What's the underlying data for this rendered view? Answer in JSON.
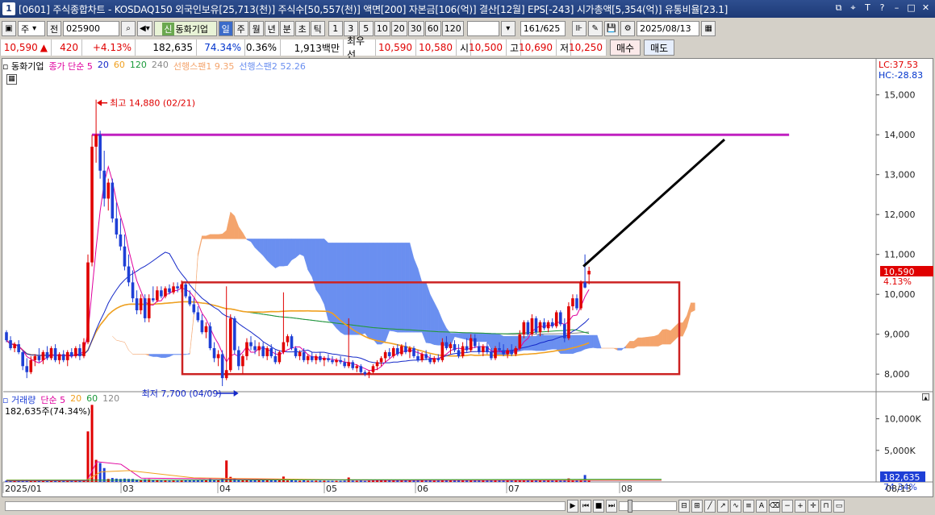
{
  "titlebar": {
    "window_index": "1",
    "title": "[0601] 주식종합차트 - KOSDAQ150 외국인보유[25,713(천)] 주식수[50,557(천)] 액면[200] 자본금[106(억)] 결산[12월] EPS[-243] 시가총액[5,354(억)] 유통비율[23.1]"
  },
  "toolbar": {
    "market": "주",
    "prev_label": "전",
    "code": "025900",
    "stock_tag": "신",
    "stock_name": "동화기업",
    "periods": [
      "일",
      "주",
      "월",
      "년",
      "분",
      "초",
      "틱"
    ],
    "active_period": "일",
    "intervals": [
      "1",
      "3",
      "5",
      "10",
      "20",
      "30",
      "60",
      "120"
    ],
    "count": "161",
    "total": "/625",
    "date": "2025/08/13"
  },
  "quote": {
    "price": "10,590",
    "change_arrow": "▲",
    "change": "420",
    "change_pct": "+4.13%",
    "volume": "182,635",
    "vol_ratio": "74.34%",
    "turnover": "0.36%",
    "amount": "1,913백만",
    "best_label": "최우선",
    "best_ask": "10,590",
    "best_bid": "10,580",
    "open_label": "시",
    "open": "10,500",
    "high_label": "고",
    "high": "10,690",
    "low_label": "저",
    "low": "10,250",
    "buy_label": "매수",
    "sell_label": "매도"
  },
  "legend": {
    "stock": "동화기업",
    "ma_label": "종가 단순 5",
    "ma20": "20",
    "ma60": "60",
    "ma120": "120",
    "ma240": "240",
    "span1": "선행스팬1 9.35",
    "span2": "선행스팬2 52.26",
    "lc": "LC:37.53",
    "hc": "HC:-28.83"
  },
  "volume_legend": {
    "label": "거래량",
    "ma_label": "단순 5",
    "ma20": "20",
    "ma60": "60",
    "ma120": "120",
    "info": "182,635주(74.34%)"
  },
  "colors": {
    "up": "#e00000",
    "down": "#1e3fd6",
    "cloud_blue": "#6a8ff0",
    "cloud_orange": "#f4a46c",
    "ma5": "#e0009e",
    "ma20": "#1428c8",
    "ma60": "#f0a020",
    "ma120": "#1a9a3a",
    "ma240": "#888888",
    "box": "#cc2222",
    "hline": "#c020c0"
  },
  "chart_data": {
    "type": "candlestick",
    "y_unit": "KRW",
    "ylim": [
      7600,
      15600
    ],
    "y_ticks": [
      8000,
      9000,
      10000,
      11000,
      12000,
      13000,
      14000,
      15000
    ],
    "y_tick_labels": [
      "8,000",
      "9,000",
      "10,000",
      "11,000",
      "12,000",
      "13,000",
      "14,000",
      "15,000"
    ],
    "x_labels": [
      "2025/01",
      "03",
      "04",
      "05",
      "06",
      "07",
      "08"
    ],
    "x_end_label": "08/13",
    "annotations": {
      "high": "최고 14,880 (02/21)",
      "low": "최저 7,700 (04/09)",
      "current": "10,590",
      "current_pct": "4.13%"
    },
    "horizontal_line_value": 14000,
    "ohlc": [
      {
        "o": 9050,
        "h": 9100,
        "l": 8800,
        "c": 8850
      },
      {
        "o": 8850,
        "h": 8950,
        "l": 8600,
        "c": 8650
      },
      {
        "o": 8650,
        "h": 8800,
        "l": 8550,
        "c": 8750
      },
      {
        "o": 8750,
        "h": 8850,
        "l": 8500,
        "c": 8550
      },
      {
        "o": 8550,
        "h": 8600,
        "l": 8100,
        "c": 8200
      },
      {
        "o": 8200,
        "h": 8400,
        "l": 7900,
        "c": 8050
      },
      {
        "o": 8050,
        "h": 8450,
        "l": 8000,
        "c": 8350
      },
      {
        "o": 8350,
        "h": 8500,
        "l": 8200,
        "c": 8450
      },
      {
        "o": 8450,
        "h": 8650,
        "l": 8300,
        "c": 8350
      },
      {
        "o": 8350,
        "h": 8600,
        "l": 8250,
        "c": 8550
      },
      {
        "o": 8550,
        "h": 8700,
        "l": 8350,
        "c": 8400
      },
      {
        "o": 8400,
        "h": 8700,
        "l": 8350,
        "c": 8650
      },
      {
        "o": 8650,
        "h": 8750,
        "l": 8300,
        "c": 8350
      },
      {
        "o": 8350,
        "h": 8550,
        "l": 8250,
        "c": 8500
      },
      {
        "o": 8500,
        "h": 8600,
        "l": 8300,
        "c": 8350
      },
      {
        "o": 8350,
        "h": 8600,
        "l": 8200,
        "c": 8550
      },
      {
        "o": 8550,
        "h": 8650,
        "l": 8400,
        "c": 8450
      },
      {
        "o": 8450,
        "h": 8700,
        "l": 8400,
        "c": 8650
      },
      {
        "o": 8650,
        "h": 8750,
        "l": 8350,
        "c": 8450
      },
      {
        "o": 8450,
        "h": 8900,
        "l": 8400,
        "c": 8800
      },
      {
        "o": 8800,
        "h": 11000,
        "l": 8750,
        "c": 10800
      },
      {
        "o": 10800,
        "h": 14000,
        "l": 10700,
        "c": 13700
      },
      {
        "o": 13700,
        "h": 14880,
        "l": 13300,
        "c": 14000
      },
      {
        "o": 14000,
        "h": 14100,
        "l": 12900,
        "c": 13100
      },
      {
        "o": 13100,
        "h": 13600,
        "l": 12200,
        "c": 12400
      },
      {
        "o": 12400,
        "h": 12900,
        "l": 12100,
        "c": 12800
      },
      {
        "o": 12800,
        "h": 12900,
        "l": 11800,
        "c": 11900
      },
      {
        "o": 11900,
        "h": 12300,
        "l": 11400,
        "c": 11500
      },
      {
        "o": 11500,
        "h": 11900,
        "l": 11100,
        "c": 11200
      },
      {
        "o": 11200,
        "h": 11500,
        "l": 10600,
        "c": 10700
      },
      {
        "o": 10700,
        "h": 11000,
        "l": 10200,
        "c": 10300
      },
      {
        "o": 10300,
        "h": 10600,
        "l": 9800,
        "c": 9900
      },
      {
        "o": 9900,
        "h": 10100,
        "l": 9500,
        "c": 9600
      },
      {
        "o": 9600,
        "h": 10000,
        "l": 9500,
        "c": 9900
      },
      {
        "o": 9900,
        "h": 10000,
        "l": 9300,
        "c": 9400
      },
      {
        "o": 9400,
        "h": 10000,
        "l": 9300,
        "c": 9900
      },
      {
        "o": 9900,
        "h": 10200,
        "l": 9800,
        "c": 9850
      },
      {
        "o": 9850,
        "h": 10200,
        "l": 9800,
        "c": 10100
      },
      {
        "o": 10100,
        "h": 10200,
        "l": 9900,
        "c": 9950
      },
      {
        "o": 9950,
        "h": 10200,
        "l": 9900,
        "c": 10150
      },
      {
        "o": 10150,
        "h": 10250,
        "l": 10000,
        "c": 10050
      },
      {
        "o": 10050,
        "h": 10300,
        "l": 10000,
        "c": 10200
      },
      {
        "o": 10200,
        "h": 10300,
        "l": 10050,
        "c": 10150
      },
      {
        "o": 10150,
        "h": 10350,
        "l": 10050,
        "c": 10250
      },
      {
        "o": 10250,
        "h": 10300,
        "l": 9900,
        "c": 9950
      },
      {
        "o": 9950,
        "h": 10100,
        "l": 9700,
        "c": 9750
      },
      {
        "o": 9750,
        "h": 9900,
        "l": 9500,
        "c": 9550
      },
      {
        "o": 9550,
        "h": 9700,
        "l": 9300,
        "c": 9350
      },
      {
        "o": 9350,
        "h": 9500,
        "l": 9000,
        "c": 9050
      },
      {
        "o": 9050,
        "h": 9300,
        "l": 8900,
        "c": 9200
      },
      {
        "o": 9200,
        "h": 9300,
        "l": 8600,
        "c": 8650
      },
      {
        "o": 8650,
        "h": 8800,
        "l": 8300,
        "c": 8400
      },
      {
        "o": 8400,
        "h": 8600,
        "l": 8200,
        "c": 8500
      },
      {
        "o": 8500,
        "h": 8600,
        "l": 7700,
        "c": 7900
      },
      {
        "o": 7900,
        "h": 10200,
        "l": 7850,
        "c": 8100
      },
      {
        "o": 8100,
        "h": 9500,
        "l": 8050,
        "c": 9400
      },
      {
        "o": 9400,
        "h": 9450,
        "l": 8500,
        "c": 8600
      },
      {
        "o": 8600,
        "h": 8700,
        "l": 8100,
        "c": 8200
      },
      {
        "o": 8200,
        "h": 8500,
        "l": 8000,
        "c": 8450
      },
      {
        "o": 8450,
        "h": 8900,
        "l": 8350,
        "c": 8800
      },
      {
        "o": 8800,
        "h": 8950,
        "l": 8600,
        "c": 8700
      },
      {
        "o": 8700,
        "h": 8850,
        "l": 8500,
        "c": 8600
      },
      {
        "o": 8600,
        "h": 8800,
        "l": 8450,
        "c": 8700
      },
      {
        "o": 8700,
        "h": 8800,
        "l": 8400,
        "c": 8450
      },
      {
        "o": 8450,
        "h": 8700,
        "l": 8350,
        "c": 8650
      },
      {
        "o": 8650,
        "h": 8750,
        "l": 8400,
        "c": 8450
      },
      {
        "o": 8450,
        "h": 8600,
        "l": 8250,
        "c": 8300
      },
      {
        "o": 8300,
        "h": 8600,
        "l": 8250,
        "c": 8550
      },
      {
        "o": 8550,
        "h": 10050,
        "l": 8500,
        "c": 8800
      },
      {
        "o": 8800,
        "h": 9000,
        "l": 8700,
        "c": 8950
      },
      {
        "o": 8950,
        "h": 9000,
        "l": 8600,
        "c": 8650
      },
      {
        "o": 8650,
        "h": 8700,
        "l": 8400,
        "c": 8450
      },
      {
        "o": 8450,
        "h": 8600,
        "l": 8350,
        "c": 8550
      },
      {
        "o": 8550,
        "h": 8650,
        "l": 8300,
        "c": 8350
      },
      {
        "o": 8350,
        "h": 8500,
        "l": 8250,
        "c": 8450
      },
      {
        "o": 8450,
        "h": 8550,
        "l": 8300,
        "c": 8350
      },
      {
        "o": 8350,
        "h": 8500,
        "l": 8250,
        "c": 8450
      },
      {
        "o": 8450,
        "h": 8550,
        "l": 8300,
        "c": 8350
      },
      {
        "o": 8350,
        "h": 8450,
        "l": 8200,
        "c": 8400
      },
      {
        "o": 8400,
        "h": 8500,
        "l": 8300,
        "c": 8350
      },
      {
        "o": 8350,
        "h": 8450,
        "l": 8250,
        "c": 8300
      },
      {
        "o": 8300,
        "h": 8400,
        "l": 8200,
        "c": 8350
      },
      {
        "o": 8350,
        "h": 8450,
        "l": 8250,
        "c": 8300
      },
      {
        "o": 8300,
        "h": 8400,
        "l": 8150,
        "c": 8200
      },
      {
        "o": 8200,
        "h": 9400,
        "l": 8150,
        "c": 8300
      },
      {
        "o": 8300,
        "h": 8350,
        "l": 8100,
        "c": 8150
      },
      {
        "o": 8150,
        "h": 8250,
        "l": 8050,
        "c": 8200
      },
      {
        "o": 8200,
        "h": 8250,
        "l": 8000,
        "c": 8050
      },
      {
        "o": 8050,
        "h": 8100,
        "l": 7950,
        "c": 8000
      },
      {
        "o": 8000,
        "h": 8100,
        "l": 7900,
        "c": 8050
      },
      {
        "o": 8050,
        "h": 8250,
        "l": 8000,
        "c": 8200
      },
      {
        "o": 8200,
        "h": 8350,
        "l": 8100,
        "c": 8300
      },
      {
        "o": 8300,
        "h": 8450,
        "l": 8200,
        "c": 8400
      },
      {
        "o": 8400,
        "h": 8600,
        "l": 8300,
        "c": 8550
      },
      {
        "o": 8550,
        "h": 8650,
        "l": 8400,
        "c": 8450
      },
      {
        "o": 8450,
        "h": 8700,
        "l": 8400,
        "c": 8650
      },
      {
        "o": 8650,
        "h": 8750,
        "l": 8450,
        "c": 8500
      },
      {
        "o": 8500,
        "h": 8750,
        "l": 8450,
        "c": 8700
      },
      {
        "o": 8700,
        "h": 8800,
        "l": 8500,
        "c": 8550
      },
      {
        "o": 8550,
        "h": 8700,
        "l": 8400,
        "c": 8650
      },
      {
        "o": 8650,
        "h": 8700,
        "l": 8400,
        "c": 8450
      },
      {
        "o": 8450,
        "h": 8600,
        "l": 8300,
        "c": 8350
      },
      {
        "o": 8350,
        "h": 8550,
        "l": 8300,
        "c": 8500
      },
      {
        "o": 8500,
        "h": 8600,
        "l": 8350,
        "c": 8400
      },
      {
        "o": 8400,
        "h": 8500,
        "l": 8250,
        "c": 8300
      },
      {
        "o": 8300,
        "h": 8450,
        "l": 8250,
        "c": 8400
      },
      {
        "o": 8400,
        "h": 8500,
        "l": 8300,
        "c": 8350
      },
      {
        "o": 8350,
        "h": 8900,
        "l": 8300,
        "c": 8800
      },
      {
        "o": 8800,
        "h": 8950,
        "l": 8600,
        "c": 8650
      },
      {
        "o": 8650,
        "h": 8800,
        "l": 8500,
        "c": 8750
      },
      {
        "o": 8750,
        "h": 8850,
        "l": 8550,
        "c": 8600
      },
      {
        "o": 8600,
        "h": 8750,
        "l": 8400,
        "c": 8450
      },
      {
        "o": 8450,
        "h": 8800,
        "l": 8400,
        "c": 8700
      },
      {
        "o": 8700,
        "h": 8900,
        "l": 8550,
        "c": 8600
      },
      {
        "o": 8600,
        "h": 9000,
        "l": 8550,
        "c": 8900
      },
      {
        "o": 8900,
        "h": 9000,
        "l": 8650,
        "c": 8700
      },
      {
        "o": 8700,
        "h": 8800,
        "l": 8500,
        "c": 8550
      },
      {
        "o": 8550,
        "h": 8750,
        "l": 8450,
        "c": 8700
      },
      {
        "o": 8700,
        "h": 8800,
        "l": 8500,
        "c": 8550
      },
      {
        "o": 8550,
        "h": 8650,
        "l": 8350,
        "c": 8400
      },
      {
        "o": 8400,
        "h": 8700,
        "l": 8350,
        "c": 8650
      },
      {
        "o": 8650,
        "h": 8800,
        "l": 8550,
        "c": 8600
      },
      {
        "o": 8600,
        "h": 8750,
        "l": 8450,
        "c": 8500
      },
      {
        "o": 8500,
        "h": 8650,
        "l": 8400,
        "c": 8600
      },
      {
        "o": 8600,
        "h": 8750,
        "l": 8450,
        "c": 8500
      },
      {
        "o": 8500,
        "h": 8700,
        "l": 8450,
        "c": 8650
      },
      {
        "o": 8650,
        "h": 9100,
        "l": 8600,
        "c": 9000
      },
      {
        "o": 9000,
        "h": 9350,
        "l": 8900,
        "c": 9300
      },
      {
        "o": 9300,
        "h": 9350,
        "l": 8950,
        "c": 9000
      },
      {
        "o": 9000,
        "h": 9500,
        "l": 8950,
        "c": 9400
      },
      {
        "o": 9400,
        "h": 9450,
        "l": 9000,
        "c": 9050
      },
      {
        "o": 9050,
        "h": 9350,
        "l": 8950,
        "c": 9300
      },
      {
        "o": 9300,
        "h": 9400,
        "l": 9100,
        "c": 9150
      },
      {
        "o": 9150,
        "h": 9350,
        "l": 9050,
        "c": 9300
      },
      {
        "o": 9300,
        "h": 9400,
        "l": 9150,
        "c": 9200
      },
      {
        "o": 9200,
        "h": 9600,
        "l": 9150,
        "c": 9550
      },
      {
        "o": 9550,
        "h": 9600,
        "l": 9200,
        "c": 9250
      },
      {
        "o": 9250,
        "h": 9400,
        "l": 8800,
        "c": 8900
      },
      {
        "o": 8900,
        "h": 9800,
        "l": 8850,
        "c": 9700
      },
      {
        "o": 9700,
        "h": 10000,
        "l": 9600,
        "c": 9900
      },
      {
        "o": 9900,
        "h": 10000,
        "l": 9600,
        "c": 9650
      },
      {
        "o": 9650,
        "h": 10350,
        "l": 9600,
        "c": 10300
      },
      {
        "o": 10300,
        "h": 11000,
        "l": 10150,
        "c": 10170
      },
      {
        "o": 10500,
        "h": 10690,
        "l": 10250,
        "c": 10590
      }
    ],
    "volume": {
      "ylim": [
        0,
        12500
      ],
      "y_ticks": [
        5000,
        10000
      ],
      "y_tick_labels": [
        "5,000K",
        "10,000K"
      ],
      "current_label": "182,635",
      "current_pct": "74.34%"
    }
  }
}
